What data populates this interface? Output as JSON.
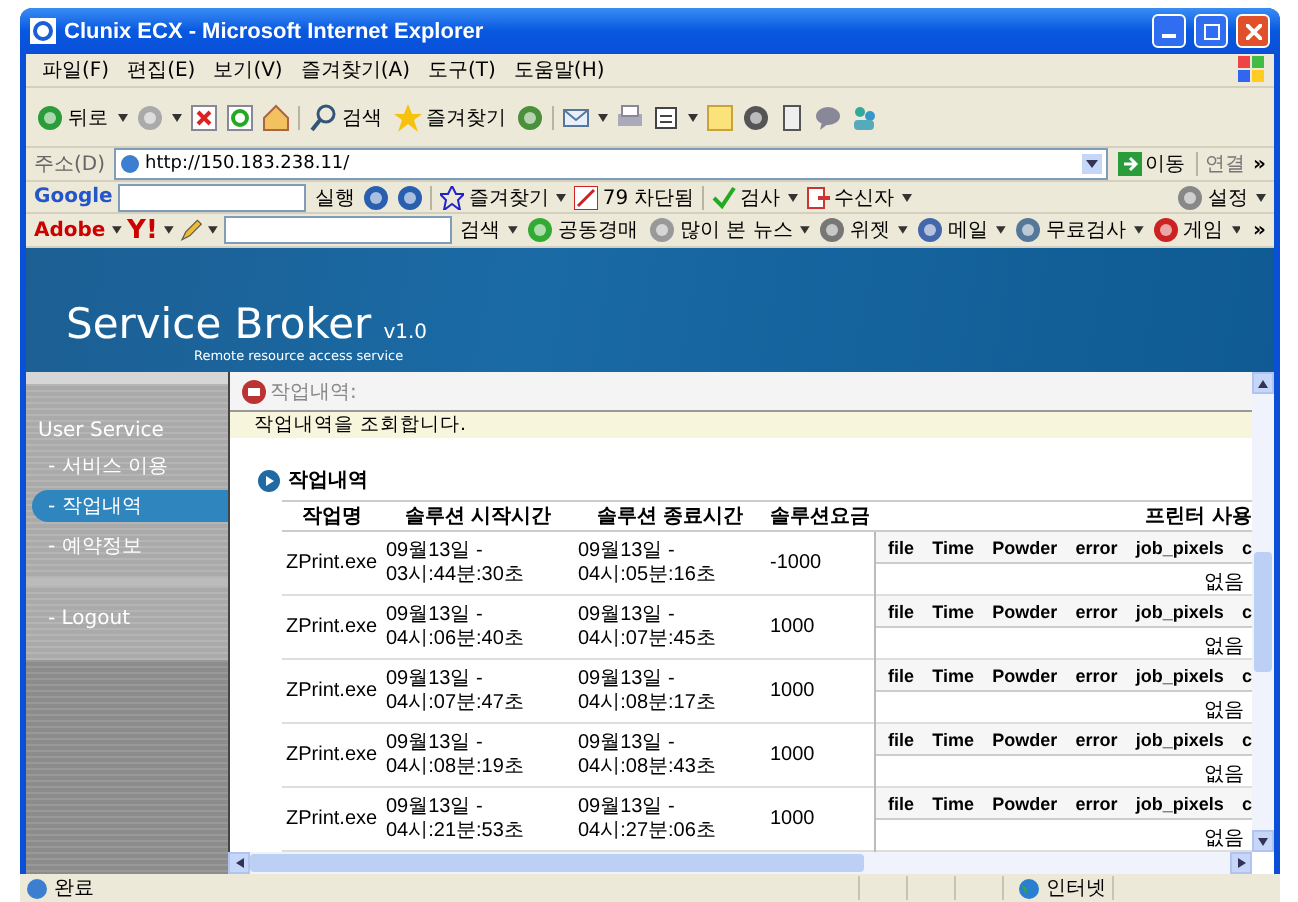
{
  "window": {
    "title": "Clunix ECX - Microsoft Internet Explorer"
  },
  "menu": [
    "파일(F)",
    "편집(E)",
    "보기(V)",
    "즐겨찾기(A)",
    "도구(T)",
    "도움말(H)"
  ],
  "toolbar": {
    "back": "뒤로",
    "search": "검색",
    "favorites": "즐겨찾기"
  },
  "address": {
    "label": "주소(D)",
    "url": "http://150.183.238.11/",
    "go": "이동",
    "links": "연결",
    "more": "»"
  },
  "google_bar": {
    "logo": "Google",
    "run": "실행",
    "favorites": "즐겨찾기",
    "blocked": "79 차단됨",
    "check": "검사",
    "recipient": "수신자",
    "settings": "설정"
  },
  "yahoo_bar": {
    "adobe": "Adobe",
    "yahoo": "Y!",
    "search": "검색",
    "items": [
      "공동경매",
      "많이 본 뉴스",
      "위젯",
      "메일",
      "무료검사",
      "게임"
    ],
    "more": "»"
  },
  "page": {
    "brand": "Service Broker",
    "version": "v1.0",
    "tagline": "Remote resource access service",
    "sidebar": {
      "heading": "User Service",
      "items": [
        {
          "label": "- 서비스 이용",
          "selected": false
        },
        {
          "label": "- 작업내역",
          "selected": true
        },
        {
          "label": "- 예약정보",
          "selected": false
        }
      ],
      "logout": "- Logout"
    },
    "breadcrumb": "작업내역:",
    "notice": "작업내역을 조회합니다.",
    "section_title": "작업내역",
    "table": {
      "columns": [
        "작업명",
        "솔루션 시작시간",
        "솔루션 종료시간",
        "솔루션요금",
        "프린터 사용"
      ],
      "rows": [
        {
          "name": "ZPrint.exe",
          "start": "09월13일 - 03시:44분:30초",
          "end": "09월13일 - 04시:05분:16초",
          "fee": "-1000",
          "printer_columns": [
            "file",
            "Time",
            "Powder",
            "error",
            "job_pixels",
            "c"
          ],
          "printer": "없음"
        },
        {
          "name": "ZPrint.exe",
          "start": "09월13일 - 04시:06분:40초",
          "end": "09월13일 - 04시:07분:45초",
          "fee": "1000",
          "printer_columns": [
            "file",
            "Time",
            "Powder",
            "error",
            "job_pixels",
            "c"
          ],
          "printer": "없음"
        },
        {
          "name": "ZPrint.exe",
          "start": "09월13일 - 04시:07분:47초",
          "end": "09월13일 - 04시:08분:17초",
          "fee": "1000",
          "printer_columns": [
            "file",
            "Time",
            "Powder",
            "error",
            "job_pixels",
            "c"
          ],
          "printer": "없음"
        },
        {
          "name": "ZPrint.exe",
          "start": "09월13일 - 04시:08분:19초",
          "end": "09월13일 - 04시:08분:43초",
          "fee": "1000",
          "printer_columns": [
            "file",
            "Time",
            "Powder",
            "error",
            "job_pixels",
            "c"
          ],
          "printer": "없음"
        },
        {
          "name": "ZPrint.exe",
          "start": "09월13일 - 04시:21분:53초",
          "end": "09월13일 - 04시:27분:06초",
          "fee": "1000",
          "printer_columns": [
            "file",
            "Time",
            "Powder",
            "error",
            "job_pixels",
            "c"
          ],
          "printer": "없음"
        }
      ]
    }
  },
  "status_bar": {
    "text": "완료",
    "zone": "인터넷"
  }
}
